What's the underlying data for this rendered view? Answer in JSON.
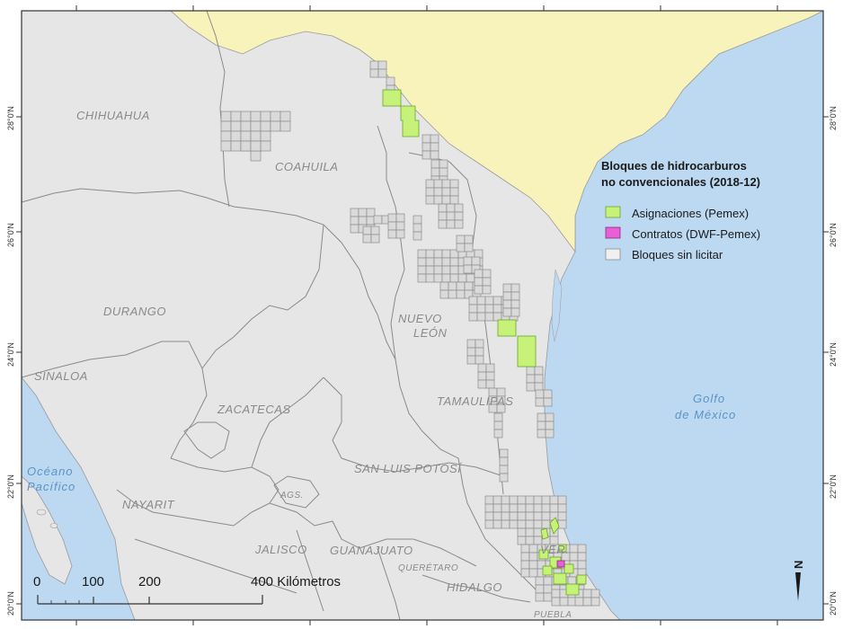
{
  "map": {
    "colors": {
      "land": "#e6e6e6",
      "us_land": "#f8f2bb",
      "water": "#bcd9f1",
      "block_fill": "#dadada",
      "block_stroke": "#8c8c8c",
      "asignaciones": "#c6f27a",
      "contratos": "#e85fd6",
      "sin_licitar": "#f0f0f0",
      "border": "#333333"
    },
    "latitude_labels": {
      "l28": "28°0'N",
      "l26": "26°0'N",
      "l24": "24°0'N",
      "l22": "22°0'N",
      "l20": "20°0'N"
    },
    "states": {
      "chihuahua": "CHIHUAHUA",
      "coahuila": "COAHUILA",
      "durango": "DURANGO",
      "nuevo_leon_1": "NUEVO",
      "nuevo_leon_2": "LEÓN",
      "sinaloa": "SINALOA",
      "zacatecas": "ZACATECAS",
      "tamaulipas": "TAMAULIPAS",
      "san_luis_potosi": "SAN LUIS POTOSÍ",
      "nayarit": "NAYARIT",
      "ags": "AGS.",
      "jalisco": "JALISCO",
      "guanajuato": "GUANAJUATO",
      "queretaro": "QUERÉTARO",
      "hidalgo": "HIDALGO",
      "puebla": "PUEBLA",
      "ver": "VER."
    },
    "water_bodies": {
      "golfo_1": "Golfo",
      "golfo_2": "de México",
      "oceano_1": "Océano",
      "oceano_2": "Pacífico"
    },
    "legend": {
      "title_line1": "Bloques de hidrocarburos",
      "title_line2": "no convencionales (2018-12)",
      "items": [
        {
          "label": "Asignaciones (Pemex)",
          "color": "#c6f27a"
        },
        {
          "label": "Contratos (DWF-Pemex)",
          "color": "#e85fd6"
        },
        {
          "label": "Bloques sin licitar",
          "color": "#f0f0f0"
        }
      ]
    },
    "scale_bar": {
      "ticks": [
        "0",
        "100",
        "200",
        "400 Kilómetros"
      ]
    },
    "north_arrow": "N"
  }
}
